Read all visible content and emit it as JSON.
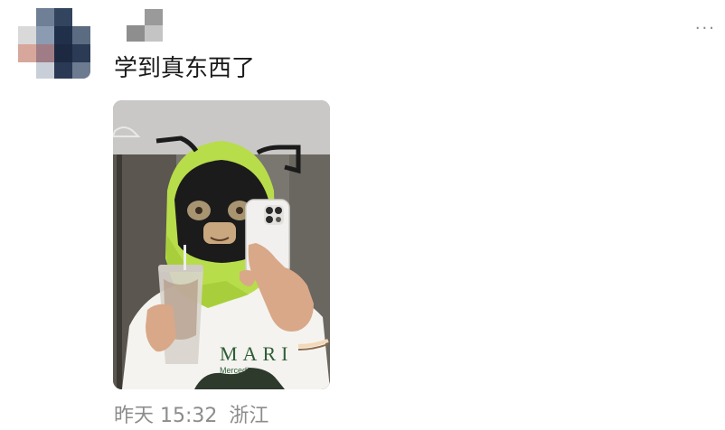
{
  "post": {
    "text": "学到真东西了",
    "time": "昨天 15:32",
    "location": "浙江",
    "more_label": "..."
  },
  "photo": {
    "shirt_text": "MARI",
    "shirt_subtext": "Mercedi"
  },
  "colors": {
    "bag_green": "#b7dd4a",
    "mask_black": "#1b1b1b",
    "phone_white": "#f1f0ee",
    "shirt_white": "#f4f3ef"
  }
}
